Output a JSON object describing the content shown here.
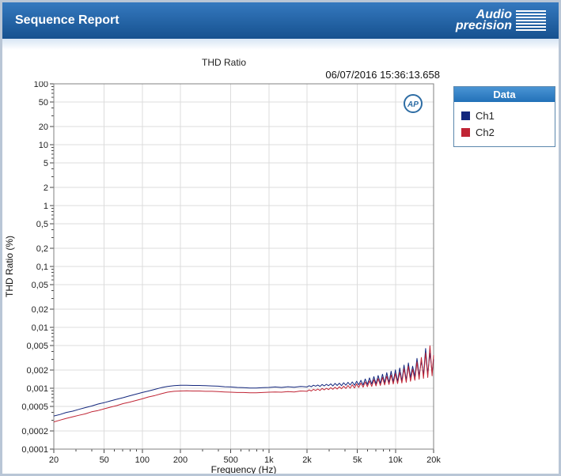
{
  "window": {
    "title": "Sequence Report"
  },
  "logo": {
    "line1": "Audio",
    "line2": "precision"
  },
  "report": {
    "title": "THD Ratio",
    "timestamp": "06/07/2016 15:36:13.658",
    "ap_badge": "AP"
  },
  "legend": {
    "header": "Data",
    "items": [
      {
        "label": "Ch1",
        "color": "#13277d"
      },
      {
        "label": "Ch2",
        "color": "#c02535"
      }
    ]
  },
  "colors": {
    "header_top": "#3579bf",
    "header_bottom": "#16518f",
    "legend_header": "#2271b8",
    "grid": "#dcdcdc",
    "plot_border": "#808080",
    "tick": "#444444",
    "ap_badge": "#2e6da4"
  },
  "chart_data": {
    "type": "line",
    "title": "THD Ratio",
    "xlabel": "Frequency (Hz)",
    "ylabel": "THD Ratio (%)",
    "x_scale": "log",
    "y_scale": "log",
    "xlim": [
      20,
      20000
    ],
    "ylim": [
      0.0001,
      100
    ],
    "grid": true,
    "legend_position": "right",
    "x_ticks": [
      {
        "v": 20,
        "label": "20"
      },
      {
        "v": 50,
        "label": "50"
      },
      {
        "v": 100,
        "label": "100"
      },
      {
        "v": 200,
        "label": "200"
      },
      {
        "v": 500,
        "label": "500"
      },
      {
        "v": 1000,
        "label": "1k"
      },
      {
        "v": 2000,
        "label": "2k"
      },
      {
        "v": 5000,
        "label": "5k"
      },
      {
        "v": 10000,
        "label": "10k"
      },
      {
        "v": 20000,
        "label": "20k"
      }
    ],
    "y_ticks": [
      {
        "v": 100,
        "label": "100"
      },
      {
        "v": 50,
        "label": "50"
      },
      {
        "v": 20,
        "label": "20"
      },
      {
        "v": 10,
        "label": "10"
      },
      {
        "v": 5,
        "label": "5"
      },
      {
        "v": 2,
        "label": "2"
      },
      {
        "v": 1,
        "label": "1"
      },
      {
        "v": 0.5,
        "label": "0,5"
      },
      {
        "v": 0.2,
        "label": "0,2"
      },
      {
        "v": 0.1,
        "label": "0,1"
      },
      {
        "v": 0.05,
        "label": "0,05"
      },
      {
        "v": 0.02,
        "label": "0,02"
      },
      {
        "v": 0.01,
        "label": "0,01"
      },
      {
        "v": 0.005,
        "label": "0,005"
      },
      {
        "v": 0.002,
        "label": "0,002"
      },
      {
        "v": 0.001,
        "label": "0,001"
      },
      {
        "v": 0.0005,
        "label": "0,0005"
      },
      {
        "v": 0.0002,
        "label": "0,0002"
      },
      {
        "v": 0.0001,
        "label": "0,0001"
      }
    ],
    "series": [
      {
        "name": "Ch1",
        "color": "#13277d",
        "points": [
          [
            20,
            0.00035
          ],
          [
            22.4,
            0.00037
          ],
          [
            25.1,
            0.0004
          ],
          [
            28.2,
            0.00042
          ],
          [
            31.6,
            0.00045
          ],
          [
            35.5,
            0.00048
          ],
          [
            39.8,
            0.00051
          ],
          [
            44.7,
            0.00055
          ],
          [
            50.1,
            0.00058
          ],
          [
            56.2,
            0.00062
          ],
          [
            63.1,
            0.00066
          ],
          [
            70.8,
            0.0007
          ],
          [
            79.4,
            0.00075
          ],
          [
            89.1,
            0.0008
          ],
          [
            100,
            0.00085
          ],
          [
            112,
            0.0009
          ],
          [
            126,
            0.00096
          ],
          [
            141,
            0.00102
          ],
          [
            158,
            0.00107
          ],
          [
            178,
            0.0011
          ],
          [
            200,
            0.00112
          ],
          [
            224,
            0.00112
          ],
          [
            251,
            0.00111
          ],
          [
            282,
            0.00111
          ],
          [
            316,
            0.0011
          ],
          [
            355,
            0.00109
          ],
          [
            398,
            0.00108
          ],
          [
            447,
            0.00106
          ],
          [
            501,
            0.00105
          ],
          [
            562,
            0.00103
          ],
          [
            631,
            0.00102
          ],
          [
            708,
            0.00101
          ],
          [
            794,
            0.00101
          ],
          [
            891,
            0.00102
          ],
          [
            1000,
            0.00103
          ],
          [
            1122,
            0.00105
          ],
          [
            1259,
            0.00103
          ],
          [
            1413,
            0.00106
          ],
          [
            1585,
            0.00104
          ],
          [
            1778,
            0.00107
          ],
          [
            2000,
            0.00105
          ],
          [
            2080,
            0.0011
          ],
          [
            2163,
            0.00106
          ],
          [
            2250,
            0.00112
          ],
          [
            2340,
            0.00108
          ],
          [
            2433,
            0.00113
          ],
          [
            2531,
            0.00107
          ],
          [
            2632,
            0.00115
          ],
          [
            2737,
            0.00109
          ],
          [
            2847,
            0.00116
          ],
          [
            2960,
            0.0011
          ],
          [
            3079,
            0.00118
          ],
          [
            3202,
            0.00109
          ],
          [
            3330,
            0.0012
          ],
          [
            3463,
            0.00111
          ],
          [
            3602,
            0.00121
          ],
          [
            3746,
            0.0011
          ],
          [
            3896,
            0.00123
          ],
          [
            4052,
            0.00112
          ],
          [
            4214,
            0.00125
          ],
          [
            4382,
            0.00113
          ],
          [
            4558,
            0.00127
          ],
          [
            4740,
            0.00112
          ],
          [
            4930,
            0.0013
          ],
          [
            5127,
            0.00114
          ],
          [
            5332,
            0.00135
          ],
          [
            5545,
            0.00113
          ],
          [
            5767,
            0.00142
          ],
          [
            5998,
            0.00115
          ],
          [
            6238,
            0.00148
          ],
          [
            6487,
            0.00117
          ],
          [
            6747,
            0.00155
          ],
          [
            7017,
            0.00118
          ],
          [
            7297,
            0.00162
          ],
          [
            7589,
            0.0012
          ],
          [
            7893,
            0.0017
          ],
          [
            8209,
            0.00122
          ],
          [
            8537,
            0.0018
          ],
          [
            8879,
            0.00124
          ],
          [
            9234,
            0.0019
          ],
          [
            9603,
            0.00126
          ],
          [
            9987,
            0.002
          ],
          [
            10387,
            0.00128
          ],
          [
            10802,
            0.00215
          ],
          [
            11234,
            0.0013
          ],
          [
            11683,
            0.0024
          ],
          [
            12151,
            0.00135
          ],
          [
            12637,
            0.0026
          ],
          [
            13142,
            0.0015
          ],
          [
            13668,
            0.0023
          ],
          [
            14215,
            0.00155
          ],
          [
            14784,
            0.0031
          ],
          [
            15375,
            0.0016
          ],
          [
            15990,
            0.0028
          ],
          [
            16630,
            0.00165
          ],
          [
            17295,
            0.0045
          ],
          [
            17987,
            0.0017
          ],
          [
            18706,
            0.0038
          ],
          [
            19455,
            0.0018
          ],
          [
            20000,
            0.003
          ]
        ]
      },
      {
        "name": "Ch2",
        "color": "#c02535",
        "points": [
          [
            20,
            0.00028
          ],
          [
            22.4,
            0.0003
          ],
          [
            25.1,
            0.00032
          ],
          [
            28.2,
            0.00034
          ],
          [
            31.6,
            0.00036
          ],
          [
            35.5,
            0.00038
          ],
          [
            39.8,
            0.00041
          ],
          [
            44.7,
            0.00043
          ],
          [
            50.1,
            0.00046
          ],
          [
            56.2,
            0.00049
          ],
          [
            63.1,
            0.00052
          ],
          [
            70.8,
            0.00056
          ],
          [
            79.4,
            0.00059
          ],
          [
            89.1,
            0.00063
          ],
          [
            100,
            0.00067
          ],
          [
            112,
            0.00072
          ],
          [
            126,
            0.00076
          ],
          [
            141,
            0.00081
          ],
          [
            158,
            0.00086
          ],
          [
            178,
            0.00089
          ],
          [
            200,
            0.0009
          ],
          [
            224,
            0.00091
          ],
          [
            251,
            0.0009
          ],
          [
            282,
            0.0009
          ],
          [
            316,
            0.00089
          ],
          [
            355,
            0.00089
          ],
          [
            398,
            0.00088
          ],
          [
            447,
            0.00087
          ],
          [
            501,
            0.00086
          ],
          [
            562,
            0.00085
          ],
          [
            631,
            0.00085
          ],
          [
            708,
            0.00084
          ],
          [
            794,
            0.00084
          ],
          [
            891,
            0.00085
          ],
          [
            1000,
            0.00086
          ],
          [
            1122,
            0.00087
          ],
          [
            1259,
            0.00086
          ],
          [
            1413,
            0.00088
          ],
          [
            1585,
            0.00087
          ],
          [
            1778,
            0.0009
          ],
          [
            2000,
            0.00089
          ],
          [
            2080,
            0.00094
          ],
          [
            2163,
            0.0009
          ],
          [
            2250,
            0.00096
          ],
          [
            2340,
            0.00092
          ],
          [
            2433,
            0.00097
          ],
          [
            2531,
            0.00092
          ],
          [
            2632,
            0.00099
          ],
          [
            2737,
            0.00094
          ],
          [
            2847,
            0.001
          ],
          [
            2960,
            0.00095
          ],
          [
            3079,
            0.00102
          ],
          [
            3202,
            0.00096
          ],
          [
            3330,
            0.00104
          ],
          [
            3463,
            0.00097
          ],
          [
            3602,
            0.00106
          ],
          [
            3746,
            0.00098
          ],
          [
            3896,
            0.00108
          ],
          [
            4052,
            0.00099
          ],
          [
            4214,
            0.00111
          ],
          [
            4382,
            0.001
          ],
          [
            4558,
            0.00114
          ],
          [
            4740,
            0.00101
          ],
          [
            4930,
            0.00118
          ],
          [
            5127,
            0.00103
          ],
          [
            5332,
            0.00122
          ],
          [
            5545,
            0.00104
          ],
          [
            5767,
            0.00127
          ],
          [
            5998,
            0.00106
          ],
          [
            6238,
            0.00132
          ],
          [
            6487,
            0.00107
          ],
          [
            6747,
            0.00138
          ],
          [
            7017,
            0.00109
          ],
          [
            7297,
            0.00144
          ],
          [
            7589,
            0.00111
          ],
          [
            7893,
            0.00151
          ],
          [
            8209,
            0.00113
          ],
          [
            8537,
            0.00158
          ],
          [
            8879,
            0.00115
          ],
          [
            9234,
            0.00166
          ],
          [
            9603,
            0.00117
          ],
          [
            9987,
            0.00174
          ],
          [
            10387,
            0.00119
          ],
          [
            10802,
            0.00183
          ],
          [
            11234,
            0.00122
          ],
          [
            11683,
            0.0021
          ],
          [
            12151,
            0.00125
          ],
          [
            12637,
            0.0023
          ],
          [
            13142,
            0.0013
          ],
          [
            13668,
            0.00205
          ],
          [
            14215,
            0.00135
          ],
          [
            14784,
            0.0027
          ],
          [
            15375,
            0.0014
          ],
          [
            15990,
            0.0032
          ],
          [
            16630,
            0.00145
          ],
          [
            17295,
            0.0038
          ],
          [
            17987,
            0.0015
          ],
          [
            18706,
            0.005
          ],
          [
            19455,
            0.0016
          ],
          [
            20000,
            0.0035
          ]
        ]
      }
    ]
  }
}
